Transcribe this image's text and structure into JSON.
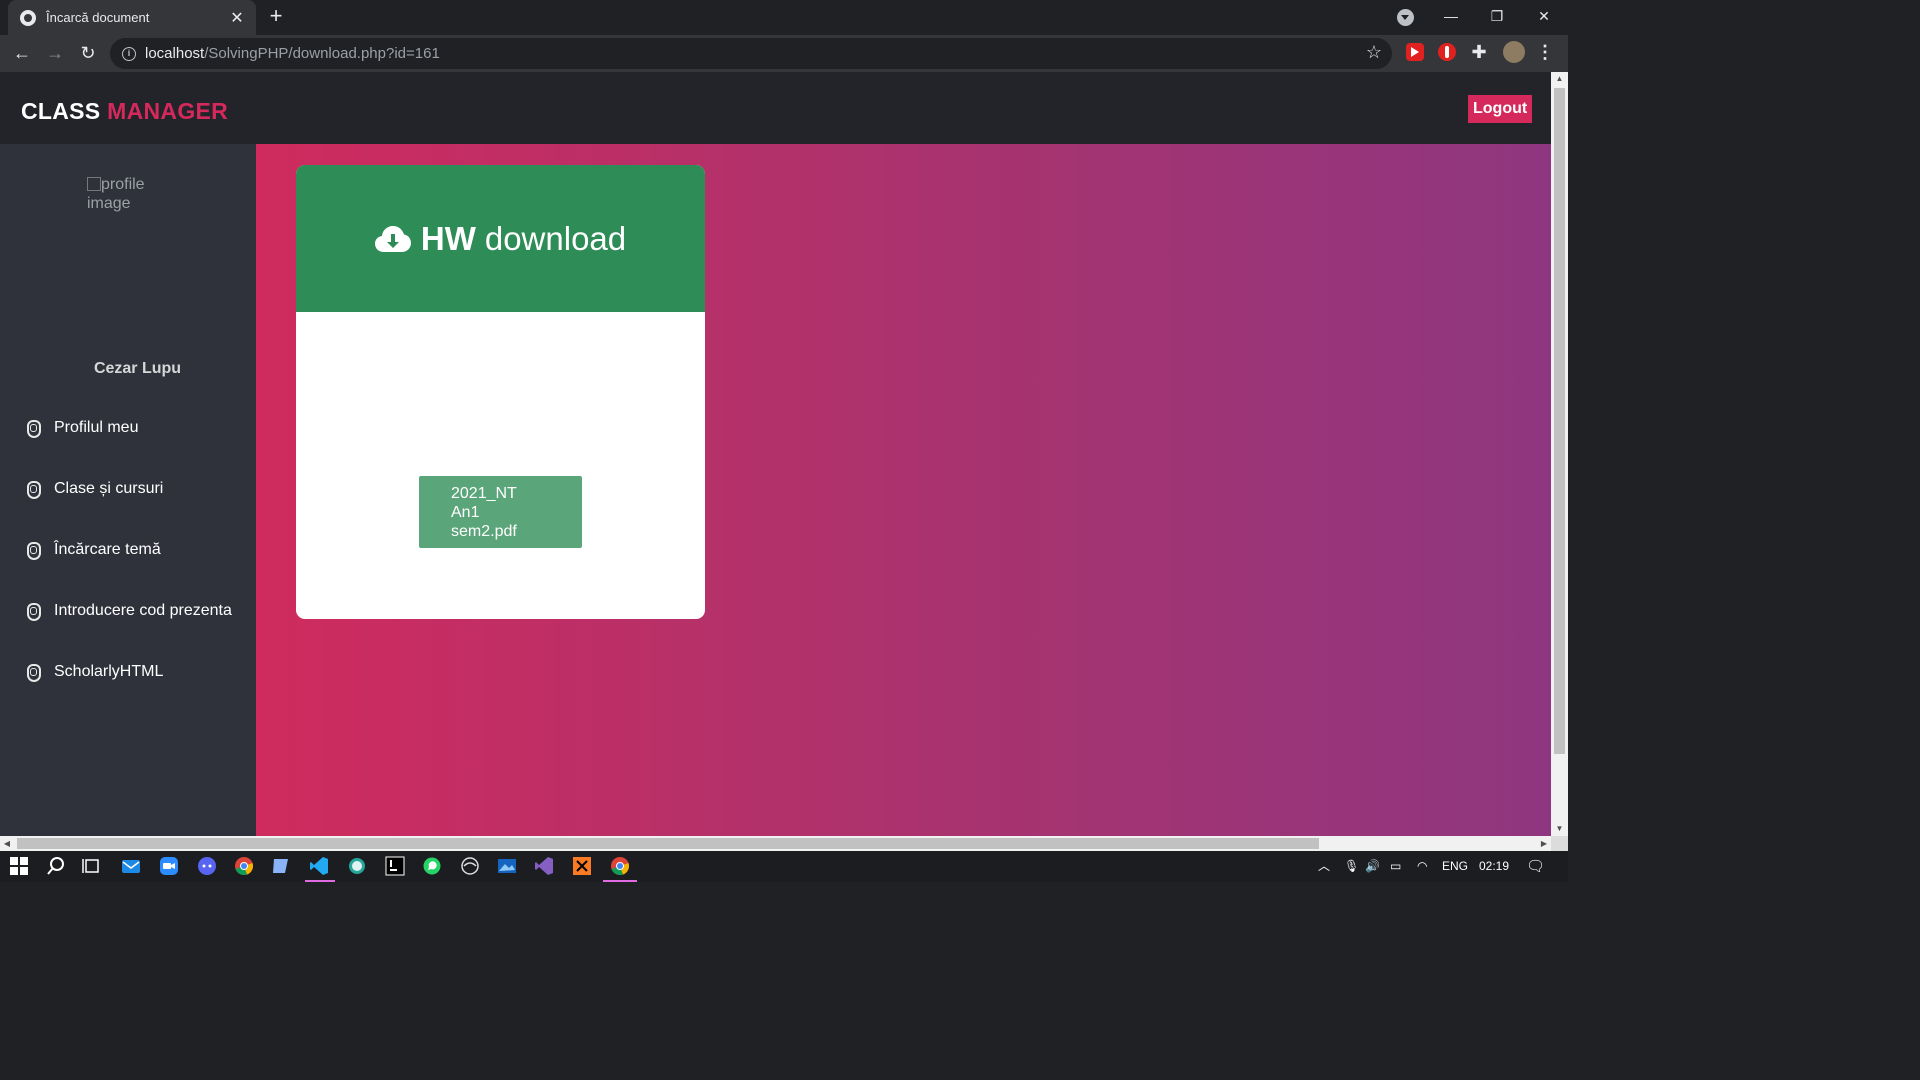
{
  "browser": {
    "tab_title": "Încarcă document",
    "url_host": "localhost",
    "url_path": "/SolvingPHP/download.php?id=161"
  },
  "header": {
    "brand_part1": "CLASS",
    "brand_part2": "MANAGER",
    "logout_label": "Logout"
  },
  "sidebar": {
    "profile_image_alt": "profile image",
    "user_name": "Cezar Lupu",
    "items": [
      {
        "label": "Profilul meu"
      },
      {
        "label": "Clase și cursuri"
      },
      {
        "label": "Încărcare temă"
      },
      {
        "label": "Introducere cod prezenta"
      },
      {
        "label": "ScholarlyHTML"
      }
    ]
  },
  "card": {
    "title_bold": "HW",
    "title_rest": "download",
    "file_lines": [
      "2021_NT",
      "An1",
      "sem2.pdf"
    ]
  },
  "taskbar": {
    "language": "ENG",
    "time": "02:19"
  },
  "colors": {
    "accent": "#d5295c",
    "card_header": "#2e8c57",
    "file_button": "#5ba57a",
    "sidebar": "#2f323a",
    "header": "#22242a"
  }
}
